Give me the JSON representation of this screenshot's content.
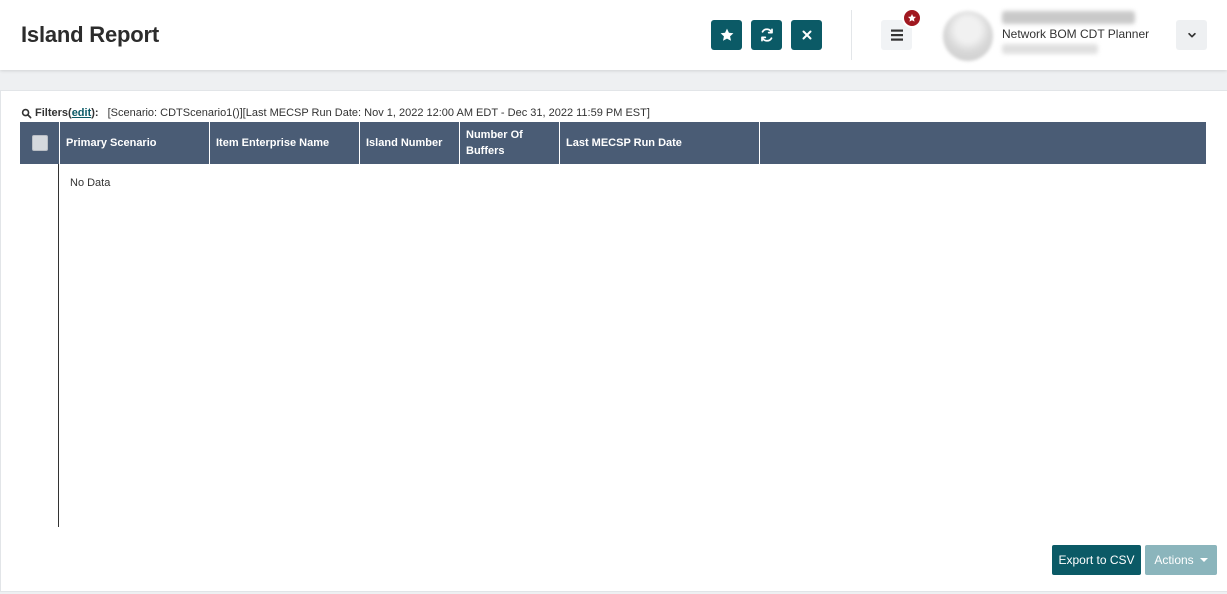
{
  "header": {
    "title": "Island Report",
    "favorite_icon": "star-icon",
    "refresh_icon": "refresh-icon",
    "close_icon": "close-icon",
    "menu_icon": "hamburger-menu-icon",
    "notification_icon": "star-badge-icon"
  },
  "user": {
    "role": "Network BOM CDT Planner",
    "dropdown_icon": "chevron-down-icon"
  },
  "filters": {
    "label": "Filters",
    "edit_open": " (",
    "edit_label": "edit",
    "edit_close": "):",
    "text": "[Scenario: CDTScenario1()][Last MECSP Run Date: Nov 1, 2022 12:00 AM EDT - Dec 31, 2022 11:59 PM EST]"
  },
  "table": {
    "columns": [
      {
        "label": "Primary Scenario"
      },
      {
        "label": "Item Enterprise Name"
      },
      {
        "label": "Island Number"
      },
      {
        "label": "Number Of Buffers"
      },
      {
        "label": "Last MECSP Run Date"
      }
    ],
    "empty_text": "No Data"
  },
  "footer": {
    "export_label": "Export to CSV",
    "actions_label": "Actions"
  },
  "colors": {
    "primary": "#0b5a66",
    "table_header": "#4a5c75",
    "actions_disabled": "#8bb5bc",
    "badge": "#a01820"
  }
}
